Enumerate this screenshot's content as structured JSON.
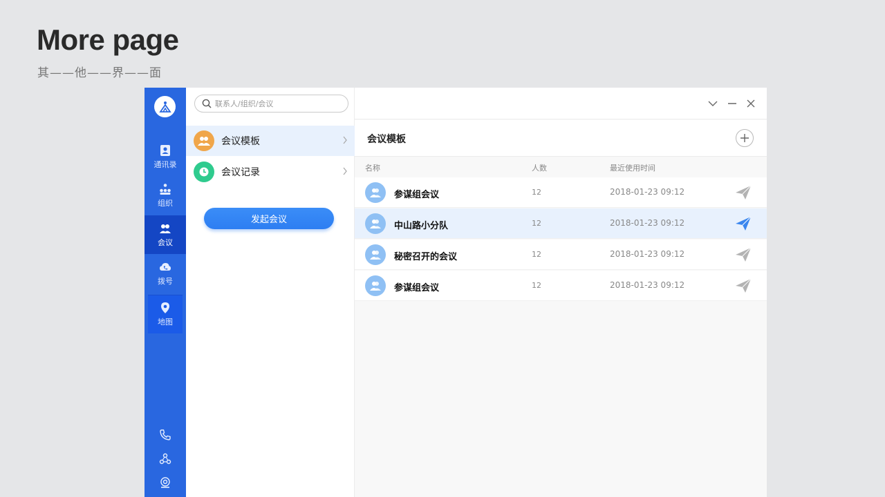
{
  "page": {
    "title": "More page",
    "subtitle": "其——他——界——面"
  },
  "nav": {
    "items": [
      {
        "label": "通讯录",
        "icon": "contacts-icon"
      },
      {
        "label": "组织",
        "icon": "organization-icon"
      },
      {
        "label": "会议",
        "icon": "meeting-icon"
      },
      {
        "label": "拨号",
        "icon": "dial-icon"
      },
      {
        "label": "地图",
        "icon": "map-pin-icon"
      }
    ],
    "active": "会议",
    "bottom_icons": [
      "phone-icon",
      "share-nodes-icon",
      "camera-icon"
    ]
  },
  "search": {
    "placeholder": "联系人/组织/会议"
  },
  "menu": {
    "items": [
      {
        "label": "会议模板",
        "icon": "group-icon",
        "color": "#f0a64a"
      },
      {
        "label": "会议记录",
        "icon": "clock-icon",
        "color": "#2fcb8e"
      }
    ],
    "selected": "会议模板"
  },
  "start_button": {
    "label": "发起会议"
  },
  "window_controls": [
    "minimize-dropdown-icon",
    "minimize-icon",
    "close-icon"
  ],
  "panel": {
    "title": "会议模板",
    "columns": {
      "name": "名称",
      "count": "人数",
      "time": "最近使用时间"
    },
    "rows": [
      {
        "name": "参谋组会议",
        "count": "12",
        "time": "2018-01-23 09:12",
        "highlighted": false
      },
      {
        "name": "中山路小分队",
        "count": "12",
        "time": "2018-01-23 09:12",
        "highlighted": true
      },
      {
        "name": "秘密召开的会议",
        "count": "12",
        "time": "2018-01-23 09:12",
        "highlighted": false
      },
      {
        "name": "参谋组会议",
        "count": "12",
        "time": "2018-01-23 09:12",
        "highlighted": false
      }
    ]
  },
  "colors": {
    "nav_bg": "#2967e0",
    "nav_active": "#1446c4",
    "accent": "#2d7ef2",
    "row_highlight": "#e8f1fd",
    "send_active": "#3a86ee",
    "send_inactive": "#b3b3b3"
  }
}
